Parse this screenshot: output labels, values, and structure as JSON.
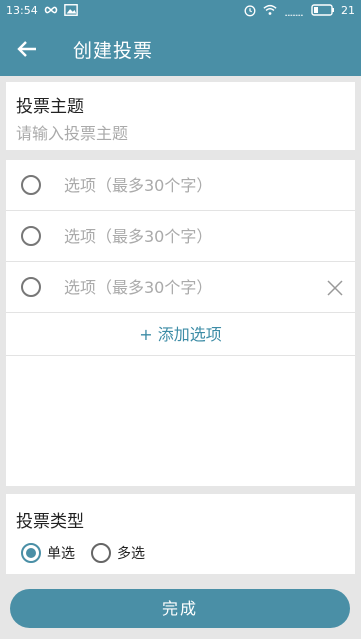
{
  "status_bar": {
    "time": "13:54",
    "battery": "21",
    "icons": [
      "infinity-icon",
      "image-icon",
      "alarm-icon",
      "wifi-icon",
      "signal-icon",
      "battery-icon"
    ]
  },
  "app_bar": {
    "title": "创建投票",
    "back_icon": "arrow-left-icon"
  },
  "subject": {
    "label": "投票主题",
    "placeholder": "请输入投票主题",
    "value": ""
  },
  "options": {
    "items": [
      {
        "placeholder": "选项（最多30个字）",
        "value": "",
        "deletable": false
      },
      {
        "placeholder": "选项（最多30个字）",
        "value": "",
        "deletable": false
      },
      {
        "placeholder": "选项（最多30个字）",
        "value": "",
        "deletable": true
      }
    ],
    "add_label": "+ 添加选项"
  },
  "vote_type": {
    "label": "投票类型",
    "choices": [
      {
        "label": "单选",
        "selected": true
      },
      {
        "label": "多选",
        "selected": false
      }
    ]
  },
  "done_button": "完成",
  "colors": {
    "primary": "#4a8fa6",
    "accent_text": "#3d8ca6",
    "background": "#e6e6e6"
  }
}
